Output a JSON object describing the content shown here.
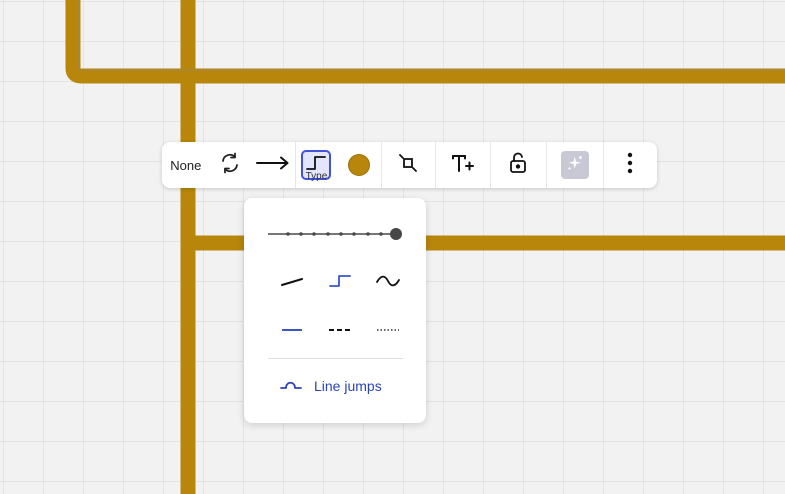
{
  "colors": {
    "connector": "#b8860b",
    "accent": "#4154d8",
    "grid": "#e3e3e3",
    "canvas": "#f2f2f2"
  },
  "toolbar": {
    "start_cap_label": "None",
    "items": [
      {
        "name": "start-cap",
        "label": "None"
      },
      {
        "name": "swap-direction",
        "icon": "swap-arrows-icon"
      },
      {
        "name": "end-cap",
        "icon": "arrow-right-icon"
      },
      {
        "name": "line-type",
        "icon": "elbow-line-icon",
        "tooltip": "Type",
        "selected": true
      },
      {
        "name": "line-color",
        "icon": "color-dot",
        "color": "#b8860b"
      },
      {
        "name": "snap-points",
        "icon": "snap-square-icon"
      },
      {
        "name": "add-text",
        "icon": "text-plus-icon"
      },
      {
        "name": "lock",
        "icon": "unlock-icon"
      },
      {
        "name": "ai-assist",
        "icon": "sparkle-icon",
        "disabled": true
      },
      {
        "name": "more",
        "icon": "more-vertical-icon"
      }
    ],
    "type_tooltip": "Type"
  },
  "line_type_panel": {
    "thickness_steps": 10,
    "thickness_selected_index": 9,
    "shapes": [
      {
        "name": "straight",
        "icon": "straight-line-icon",
        "selected": false
      },
      {
        "name": "elbow",
        "icon": "elbow-line-icon",
        "selected": true
      },
      {
        "name": "curved",
        "icon": "curved-line-icon",
        "selected": false
      }
    ],
    "styles": [
      {
        "name": "solid",
        "icon": "solid-line-icon",
        "selected": true
      },
      {
        "name": "dashed",
        "icon": "dashed-line-icon",
        "selected": false
      },
      {
        "name": "dotted",
        "icon": "dotted-line-icon",
        "selected": false
      }
    ],
    "line_jumps_label": "Line jumps"
  }
}
